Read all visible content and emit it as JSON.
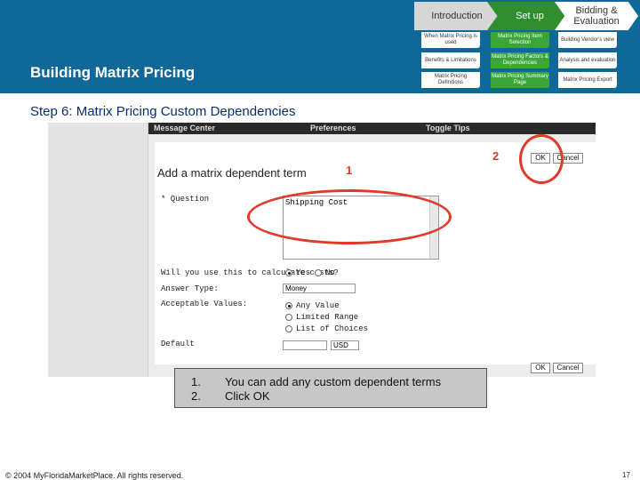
{
  "header": {
    "title": "Building Matrix Pricing",
    "tabs": [
      {
        "label": "Introduction"
      },
      {
        "label": "Set up"
      },
      {
        "label": "Bidding & Evaluation"
      }
    ],
    "subtabs": [
      {
        "label": "When Matrix Pricing is used"
      },
      {
        "label": "Matrix Pricing Item Selection"
      },
      {
        "label": "Building Vendor's view"
      },
      {
        "label": "Benefits & Limitations"
      },
      {
        "label": "Matrix Pricing Factors & Dependencies"
      },
      {
        "label": "Analysis and evaluation"
      },
      {
        "label": "Matrix Pricing Definitions"
      },
      {
        "label": "Matrix Pricing Summary Page"
      },
      {
        "label": "Matrix Pricing Export"
      }
    ]
  },
  "step_heading": "Step 6: Matrix Pricing Custom Dependencies",
  "screenshot": {
    "topbar": {
      "message_center": "Message Center",
      "preferences": "Preferences",
      "toggle_tips": "Toggle Tips"
    },
    "heading": "Add a matrix dependent term",
    "question_label": "* Question",
    "question_value": "Shipping Cost",
    "calc_label": "Will you use this to calculate costs?",
    "yes_label": "Yes",
    "no_label": "No",
    "answer_type_label": "Answer Type:",
    "answer_type_value": "Money",
    "acceptable_label": "Acceptable Values:",
    "opt_any": "Any Value",
    "opt_limited": "Limited Range",
    "opt_list": "List of Choices",
    "default_label": "Default",
    "currency_value": "USD",
    "ok_label": "OK",
    "cancel_label": "Cancel"
  },
  "markers": {
    "one": "1",
    "two": "2"
  },
  "callout": {
    "num1": "1.",
    "num2": "2.",
    "line1": "You can add any custom dependent terms",
    "line2": "Click OK"
  },
  "footer": "© 2004 MyFloridaMarketPlace. All rights reserved.",
  "page_number": "17",
  "colors": {
    "header_bg": "#10689a",
    "setup_green": "#2f8f2f",
    "highlight_red": "#e03a2a"
  }
}
